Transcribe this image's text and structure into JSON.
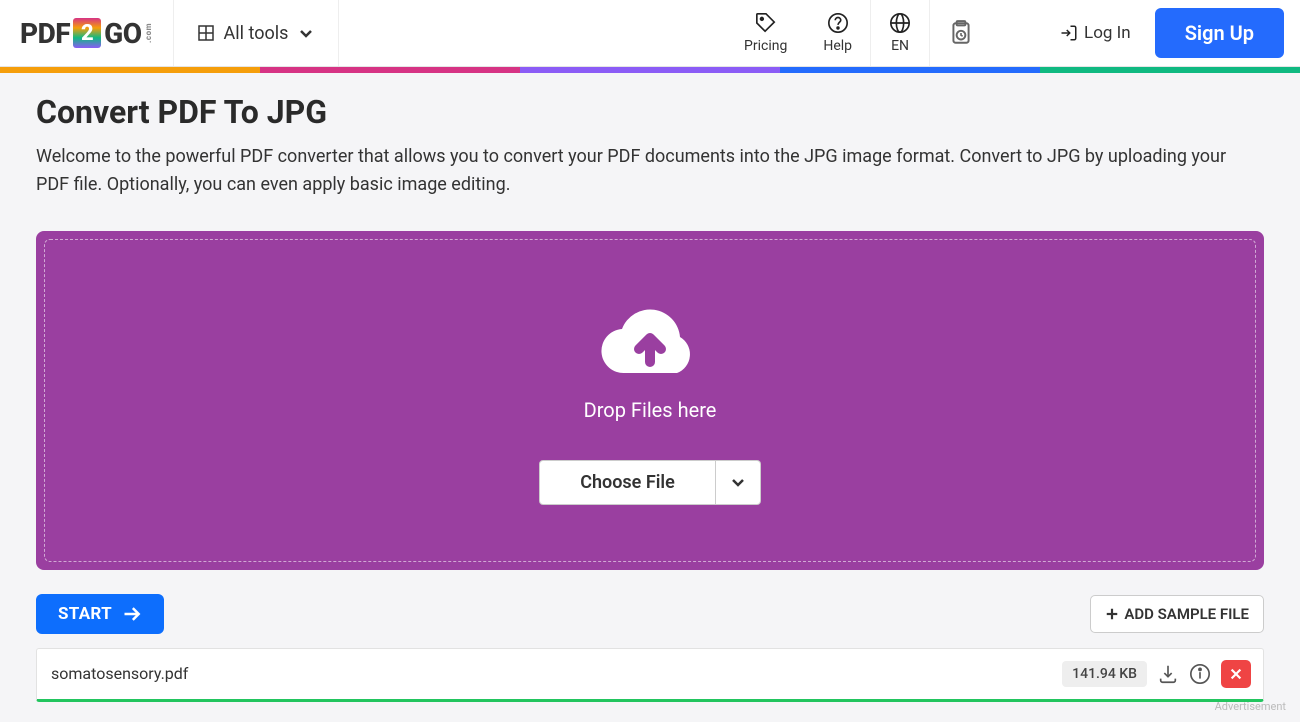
{
  "header": {
    "logo": {
      "left": "PDF",
      "center": "2",
      "right": "GO",
      "suffix": ".com"
    },
    "all_tools": "All tools",
    "pricing": "Pricing",
    "help": "Help",
    "language": "EN",
    "login": "Log In",
    "signup": "Sign Up"
  },
  "page": {
    "title": "Convert PDF To JPG",
    "subtitle": "Welcome to the powerful PDF converter that allows you to convert your PDF documents into the JPG image format. Convert to JPG by uploading your PDF file. Optionally, you can even apply basic image editing."
  },
  "dropzone": {
    "label": "Drop Files here",
    "choose_file": "Choose File"
  },
  "actions": {
    "start": "START",
    "add_sample": "ADD SAMPLE FILE"
  },
  "file": {
    "name": "somatosensory.pdf",
    "size": "141.94 KB"
  },
  "footer": {
    "ad_label": "Advertisement"
  }
}
